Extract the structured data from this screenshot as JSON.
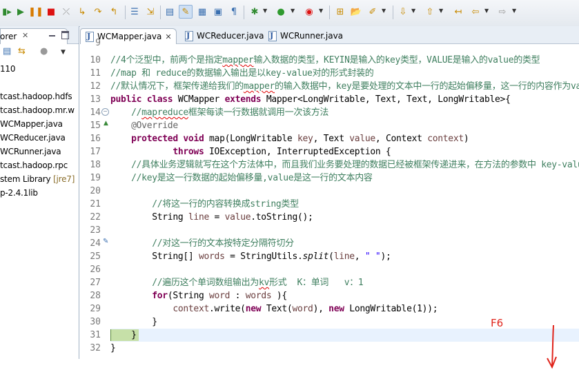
{
  "explorer": {
    "tab_label": "orer",
    "items": [
      {
        "text": "110",
        "suffix": ""
      },
      {
        "text": "",
        "suffix": ""
      },
      {
        "text": "tcast.hadoop.hdfs",
        "suffix": ""
      },
      {
        "text": "tcast.hadoop.mr.w",
        "suffix": ""
      },
      {
        "text": "WCMapper.java",
        "suffix": ""
      },
      {
        "text": "WCReducer.java",
        "suffix": ""
      },
      {
        "text": "WCRunner.java",
        "suffix": ""
      },
      {
        "text": "tcast.hadoop.rpc",
        "suffix": ""
      },
      {
        "text": "stem Library ",
        "suffix": "[jre7]"
      },
      {
        "text": "p-2.4.1lib",
        "suffix": ""
      }
    ]
  },
  "editor": {
    "tabs": [
      {
        "label": "WCMapper.java",
        "active": true
      },
      {
        "label": "WCReducer.java",
        "active": false
      },
      {
        "label": "WCRunner.java",
        "active": false
      }
    ],
    "line_numbers": [
      "10",
      "11",
      "12",
      "13",
      "14",
      "15",
      "16",
      "17",
      "18",
      "19",
      "20",
      "21",
      "22",
      "23",
      "24",
      "25",
      "26",
      "27",
      "28",
      "29",
      "30",
      "31",
      "32"
    ],
    "top_partial_number": "9"
  },
  "annotation": {
    "label": "F6",
    "color": "#e0241b"
  },
  "colors": {
    "comment": "#3f7f5f",
    "keyword": "#7f0055",
    "string": "#2a00ff",
    "field": "#6a3e3e",
    "annotation": "#646464",
    "current_line": "#e8f2fe"
  }
}
